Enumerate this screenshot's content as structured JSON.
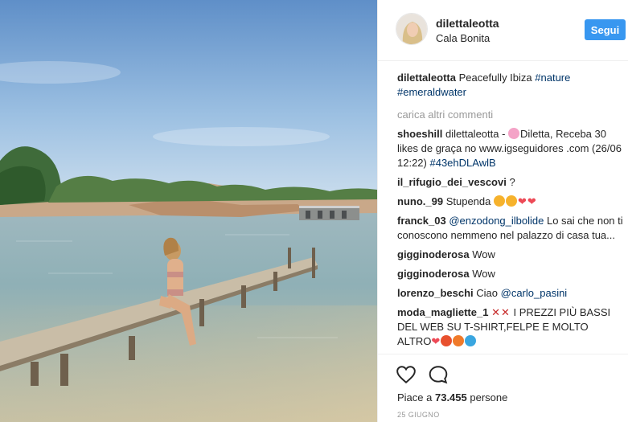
{
  "post": {
    "username": "dilettaleotta",
    "location": "Cala Bonita",
    "follow_label": "Segui",
    "caption": {
      "user": "dilettaleotta",
      "text": "Peacefully Ibiza ",
      "tag1": "#nature",
      "tag2": "#emeraldwater"
    },
    "load_more": "carica altri commenti",
    "comments": [
      {
        "user": "shoeshill",
        "pre": "dilettaleotta - ",
        "post": "Diletta, Receba 30 likes de graça no www.igseguidores .com (26/06 12:22) ",
        "tag": "#43ehDLAwlB"
      },
      {
        "user": "il_rifugio_dei_vescovi",
        "text": "?"
      },
      {
        "user": "nuno._99",
        "text": "Stupenda"
      },
      {
        "user": "franck_03",
        "mention": "@enzodong_ilbolide",
        "text": " Lo sai che non ti conoscono nemmeno nel palazzo di casa tua..."
      },
      {
        "user": "gigginoderosa",
        "text": "Wow"
      },
      {
        "user": "gigginoderosa",
        "text": "Wow"
      },
      {
        "user": "lorenzo_beschi",
        "text": "Ciao ",
        "mention": "@carlo_pasini"
      },
      {
        "user": "moda_magliette_1",
        "text": " I PREZZI PIÙ BASSI DEL WEB SU T-SHIRT,FELPE E MOLTO ALTRO"
      }
    ],
    "likes_prefix": "Piace a ",
    "likes_count": "73.455",
    "likes_suffix": " persone",
    "date": "25 GIUGNO",
    "icons": {
      "like": "heart-outline-icon",
      "comment": "speech-bubble-icon"
    },
    "colors": {
      "follow_button": "#3897f0",
      "link": "#003569",
      "muted": "#999999"
    }
  }
}
